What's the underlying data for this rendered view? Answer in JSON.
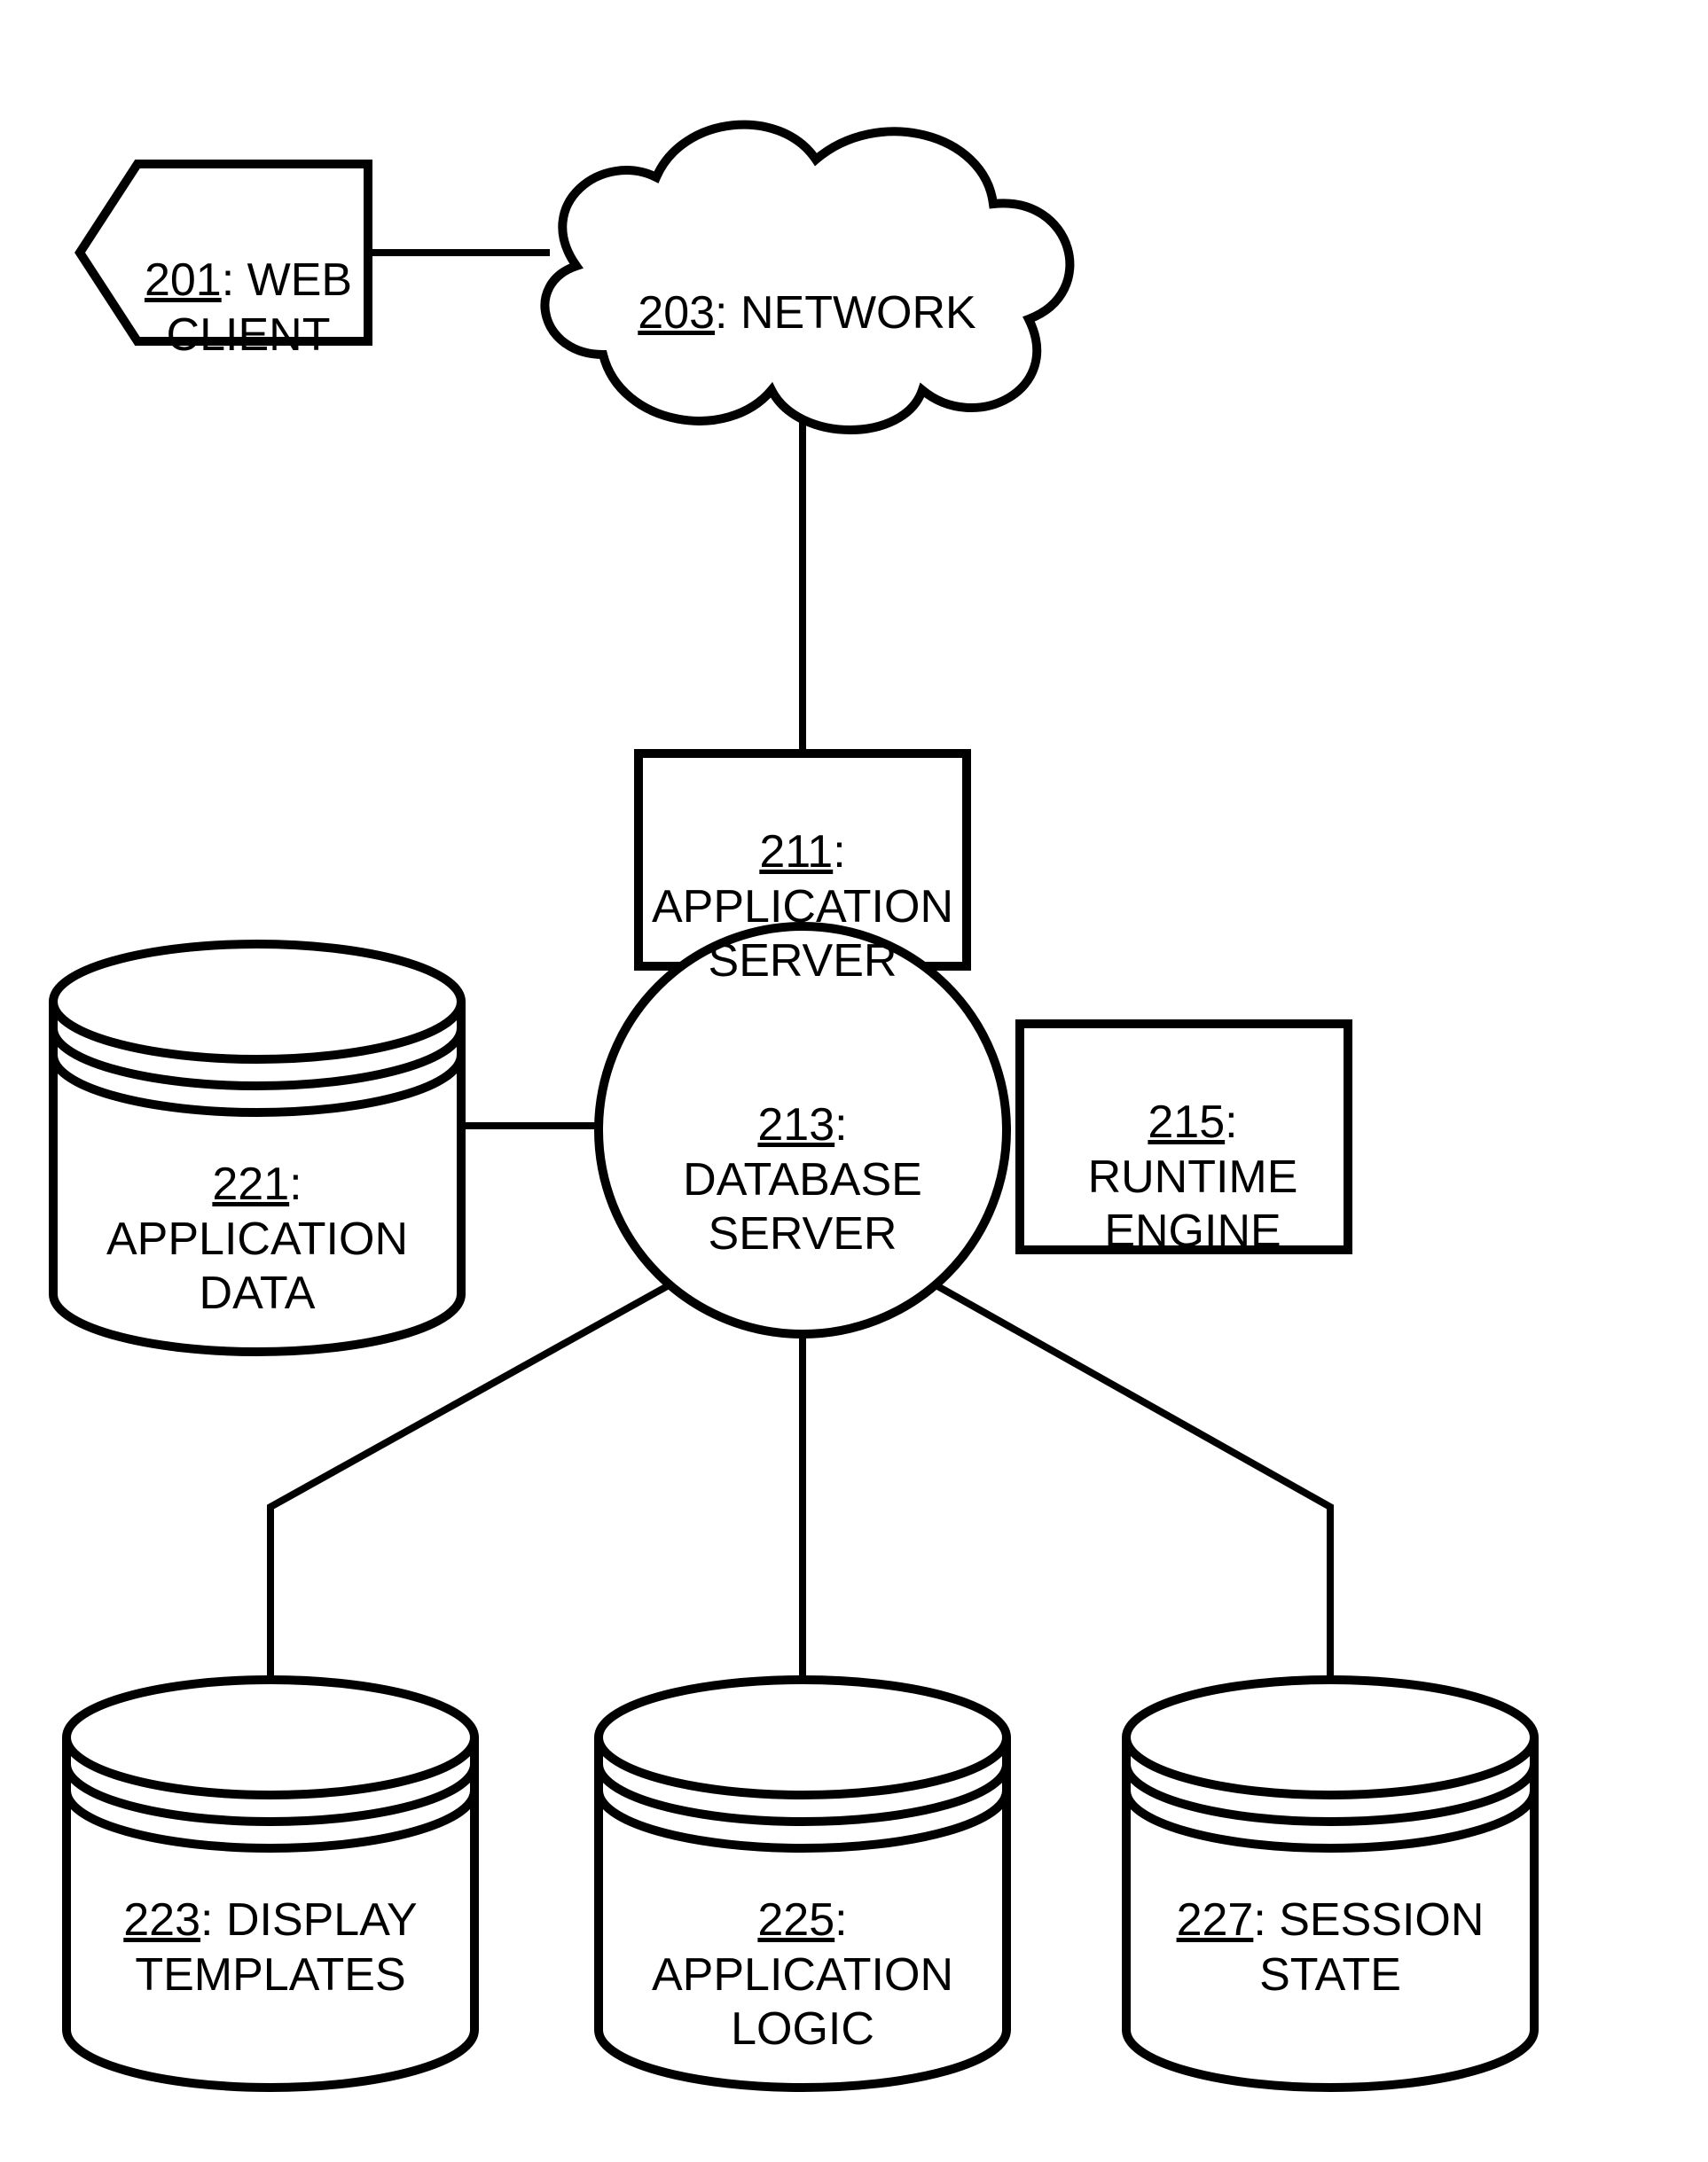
{
  "nodes": {
    "web_client": {
      "num": "201",
      "text": "WEB\nCLIENT"
    },
    "network": {
      "num": "203",
      "text": "NETWORK"
    },
    "app_server": {
      "num": "211",
      "text": "APPLICATION\nSERVER"
    },
    "db_server": {
      "num": "213",
      "text": "DATABASE\nSERVER"
    },
    "runtime": {
      "num": "215",
      "text": "RUNTIME\nENGINE"
    },
    "app_data": {
      "num": "221",
      "text": "APPLICATION\nDATA"
    },
    "display_tpl": {
      "num": "223",
      "text": "DISPLAY\nTEMPLATES"
    },
    "app_logic": {
      "num": "225",
      "text": "APPLICATION\nLOGIC"
    },
    "session": {
      "num": "227",
      "text": "SESSION\nSTATE"
    }
  }
}
